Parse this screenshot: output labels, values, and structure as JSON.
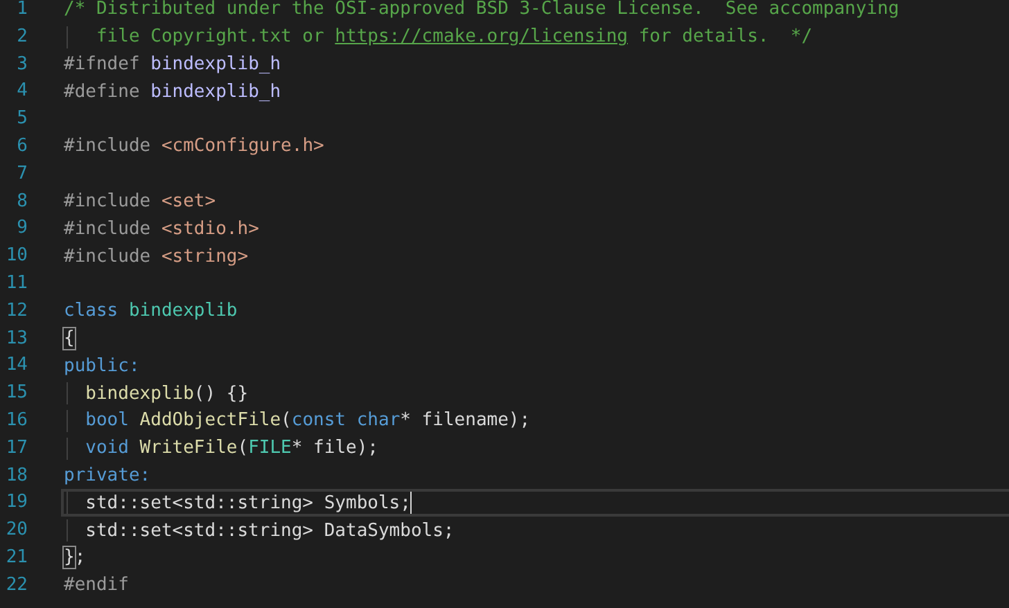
{
  "editor": {
    "lines": [
      {
        "number": "1",
        "current": false,
        "tokens": [
          {
            "text": "/* Distributed under the OSI-approved BSD 3-Clause License.  See accompanying",
            "kind": "comment"
          }
        ]
      },
      {
        "number": "2",
        "current": false,
        "tokens": [
          {
            "text": "   file Copyright.txt or ",
            "kind": "comment"
          },
          {
            "text": "https://cmake.org/licensing",
            "kind": "link"
          },
          {
            "text": " for details.  */",
            "kind": "comment"
          }
        ]
      },
      {
        "number": "3",
        "current": false,
        "tokens": [
          {
            "text": "#ifndef ",
            "kind": "preproc"
          },
          {
            "text": "bindexplib_h",
            "kind": "macro"
          }
        ]
      },
      {
        "number": "4",
        "current": false,
        "tokens": [
          {
            "text": "#define ",
            "kind": "preproc"
          },
          {
            "text": "bindexplib_h",
            "kind": "macro"
          }
        ]
      },
      {
        "number": "5",
        "current": false
      },
      {
        "number": "6",
        "current": false,
        "tokens": [
          {
            "text": "#include ",
            "kind": "preproc"
          },
          {
            "text": "<cmConfigure.h>",
            "kind": "string"
          }
        ]
      },
      {
        "number": "7",
        "current": false
      },
      {
        "number": "8",
        "current": false,
        "tokens": [
          {
            "text": "#include ",
            "kind": "preproc"
          },
          {
            "text": "<set>",
            "kind": "string"
          }
        ]
      },
      {
        "number": "9",
        "current": false,
        "tokens": [
          {
            "text": "#include ",
            "kind": "preproc"
          },
          {
            "text": "<stdio.h>",
            "kind": "string"
          }
        ]
      },
      {
        "number": "10",
        "current": false,
        "tokens": [
          {
            "text": "#include ",
            "kind": "preproc"
          },
          {
            "text": "<string>",
            "kind": "string"
          }
        ]
      },
      {
        "number": "11",
        "current": false
      },
      {
        "number": "12",
        "current": false,
        "tokens": [
          {
            "text": "class ",
            "kind": "keyword"
          },
          {
            "text": "bindexplib",
            "kind": "type"
          }
        ]
      },
      {
        "number": "13",
        "current": false,
        "tokens": [
          {
            "text": "{",
            "kind": "bracket_match"
          }
        ]
      },
      {
        "number": "14",
        "current": false,
        "tokens": [
          {
            "text": "public:",
            "kind": "keyword"
          }
        ]
      },
      {
        "number": "15",
        "current": false,
        "tokens": [
          {
            "text": "  bindexplib",
            "kind": "function"
          },
          {
            "text": "() {}",
            "kind": "plain"
          }
        ]
      },
      {
        "number": "16",
        "current": false,
        "tokens": [
          {
            "text": "  bool ",
            "kind": "keyword"
          },
          {
            "text": "AddObjectFile",
            "kind": "function"
          },
          {
            "text": "(",
            "kind": "plain"
          },
          {
            "text": "const char",
            "kind": "keyword"
          },
          {
            "text": "* filename);",
            "kind": "plain"
          }
        ]
      },
      {
        "number": "17",
        "current": false,
        "tokens": [
          {
            "text": "  void ",
            "kind": "keyword"
          },
          {
            "text": "WriteFile",
            "kind": "function"
          },
          {
            "text": "(",
            "kind": "plain"
          },
          {
            "text": "FILE",
            "kind": "type"
          },
          {
            "text": "* file);",
            "kind": "plain"
          }
        ]
      },
      {
        "number": "18",
        "current": false,
        "tokens": [
          {
            "text": "private:",
            "kind": "keyword"
          }
        ]
      },
      {
        "number": "19",
        "current": true,
        "tokens": [
          {
            "text": "  std::set<std::string> Symbols;",
            "kind": "plain"
          }
        ]
      },
      {
        "number": "20",
        "current": false,
        "tokens": [
          {
            "text": "  std::set<std::string> DataSymbols;",
            "kind": "plain"
          }
        ]
      },
      {
        "number": "21",
        "current": false,
        "tokens": [
          {
            "text": "}",
            "kind": "bracket_match"
          },
          {
            "text": ";",
            "kind": "plain"
          }
        ]
      },
      {
        "number": "22",
        "current": false,
        "tokens": [
          {
            "text": "#endif",
            "kind": "preproc"
          }
        ]
      }
    ]
  }
}
